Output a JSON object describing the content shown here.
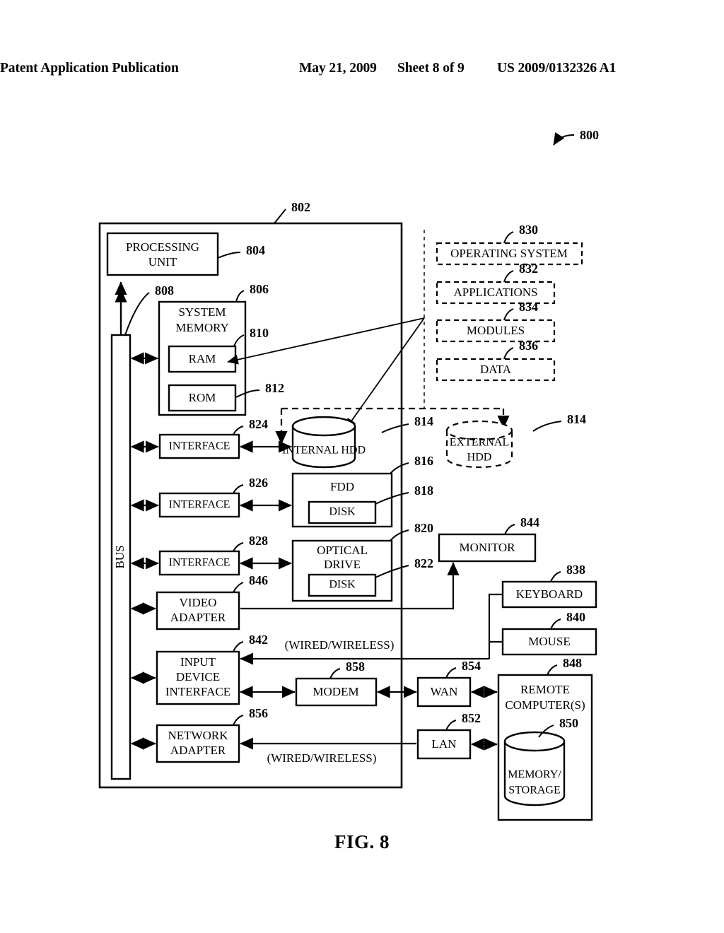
{
  "header": {
    "publication": "Patent Application Publication",
    "date": "May 21, 2009",
    "sheet": "Sheet 8 of 9",
    "patent_number": "US 2009/0132326 A1"
  },
  "figure": {
    "caption": "FIG. 8",
    "system_ref": "800"
  },
  "refs": {
    "computer": "802",
    "processing_unit": "804",
    "system_memory": "806",
    "bus": "808",
    "ram": "810",
    "rom": "812",
    "internal_hdd": "814",
    "external_hdd": "814",
    "fdd": "816",
    "fdd_disk": "818",
    "optical_drive": "820",
    "optical_disk": "822",
    "hdd_interface": "824",
    "fdd_interface": "826",
    "optical_interface": "828",
    "operating_system": "830",
    "applications": "832",
    "modules": "834",
    "data": "836",
    "keyboard": "838",
    "mouse": "840",
    "input_device_interface": "842",
    "monitor": "844",
    "video_adapter": "846",
    "remote_computers": "848",
    "memory_storage": "850",
    "lan": "852",
    "wan": "854",
    "network_adapter": "856",
    "modem": "858"
  },
  "blocks": {
    "processing_unit": [
      "PROCESSING",
      "UNIT"
    ],
    "system_memory": [
      "SYSTEM",
      "MEMORY"
    ],
    "ram": [
      "RAM"
    ],
    "rom": [
      "ROM"
    ],
    "bus": [
      "BUS"
    ],
    "hdd_interface": [
      "INTERFACE"
    ],
    "fdd_interface": [
      "INTERFACE"
    ],
    "optical_interface": [
      "INTERFACE"
    ],
    "internal_hdd": [
      "INTERNAL HDD"
    ],
    "external_hdd": [
      "EXTERNAL",
      "HDD"
    ],
    "fdd": [
      "FDD"
    ],
    "fdd_disk": [
      "DISK"
    ],
    "optical_drive": [
      "OPTICAL",
      "DRIVE"
    ],
    "optical_disk": [
      "DISK"
    ],
    "video_adapter": [
      "VIDEO",
      "ADAPTER"
    ],
    "input_device_interface": [
      "INPUT",
      "DEVICE",
      "INTERFACE"
    ],
    "network_adapter": [
      "NETWORK",
      "ADAPTER"
    ],
    "modem": [
      "MODEM"
    ],
    "monitor": [
      "MONITOR"
    ],
    "keyboard": [
      "KEYBOARD"
    ],
    "mouse": [
      "MOUSE"
    ],
    "wan": [
      "WAN"
    ],
    "lan": [
      "LAN"
    ],
    "remote_computers": [
      "REMOTE",
      "COMPUTER(S)"
    ],
    "memory_storage": [
      "MEMORY/",
      "STORAGE"
    ],
    "operating_system": [
      "OPERATING SYSTEM"
    ],
    "applications": [
      "APPLICATIONS"
    ],
    "modules": [
      "MODULES"
    ],
    "data": [
      "DATA"
    ]
  },
  "annotations": {
    "wired_wireless_upper": "(WIRED/WIRELESS)",
    "wired_wireless_lower": "(WIRED/WIRELESS)"
  },
  "colors": {
    "ink": "#000000",
    "paper": "#ffffff"
  }
}
